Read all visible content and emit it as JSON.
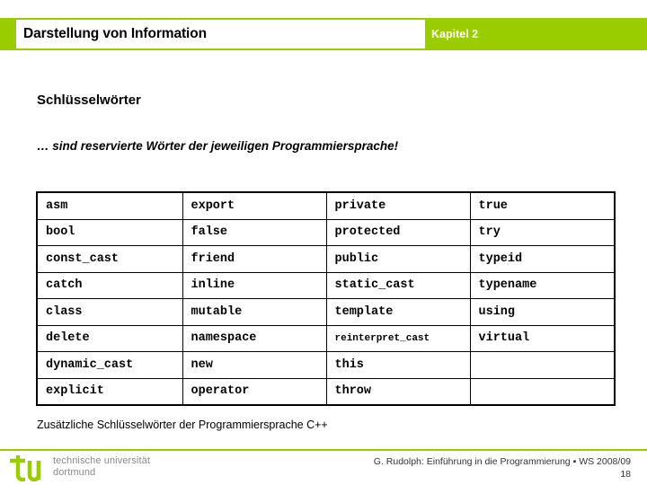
{
  "header": {
    "title": "Darstellung von Information",
    "chapter": "Kapitel 2",
    "bar_color": "#9ACD00"
  },
  "slide": {
    "heading": "Schlüsselwörter",
    "subtitle": "… sind reservierte Wörter der jeweiligen Programmiersprache!",
    "caption": "Zusätzliche Schlüsselwörter der Programmiersprache C++"
  },
  "keyword_table": {
    "rows": [
      [
        "asm",
        "export",
        "private",
        "true"
      ],
      [
        "bool",
        "false",
        "protected",
        "try"
      ],
      [
        "const_cast",
        "friend",
        "public",
        "typeid"
      ],
      [
        "catch",
        "inline",
        "static_cast",
        "typename"
      ],
      [
        "class",
        "mutable",
        "template",
        "using"
      ],
      [
        "delete",
        "namespace",
        "reinterpret_cast",
        "virtual"
      ],
      [
        "dynamic_cast",
        "new",
        "this",
        ""
      ],
      [
        "explicit",
        "operator",
        "throw",
        ""
      ]
    ]
  },
  "footer": {
    "logo_line1": "technische universität",
    "logo_line2": "dortmund",
    "credit": "G. Rudolph: Einführung in die Programmierung ▪ WS 2008/09",
    "page": "18",
    "logo_color": "#9ACD00",
    "logo_text_color": "#8a8a8a"
  }
}
